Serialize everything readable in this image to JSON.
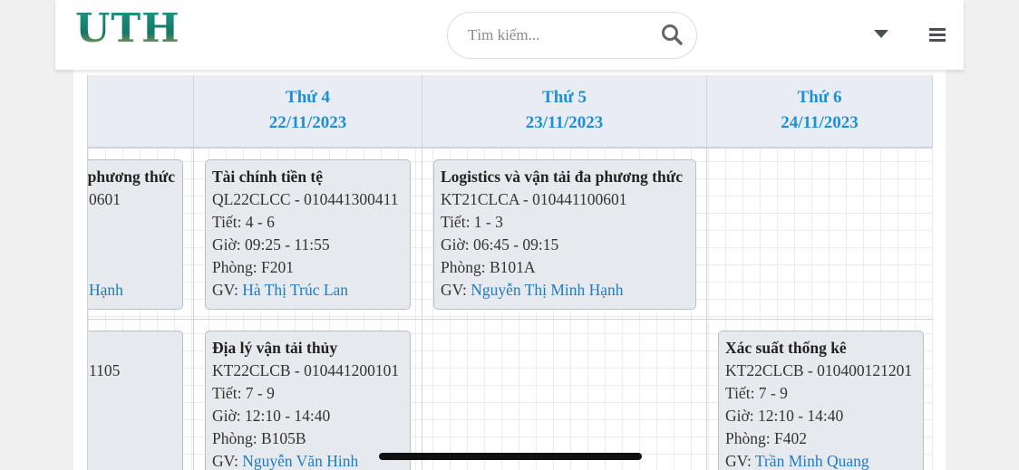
{
  "header": {
    "logo": "UTH",
    "search_placeholder": "Tìm kiếm..."
  },
  "days": [
    {
      "label": "Thứ 4",
      "date": "22/11/2023"
    },
    {
      "label": "Thứ 5",
      "date": "23/11/2023"
    },
    {
      "label": "Thứ 6",
      "date": "24/11/2023"
    }
  ],
  "partial_cards": [
    {
      "line1": "phương thức",
      "line2": "0601",
      "line6": "Hạnh"
    },
    {
      "line2": "1105"
    }
  ],
  "classes": [
    {
      "title": "Tài chính tiền tệ",
      "code": "QL22CLCC - 010441300411",
      "period": "Tiết: 4 - 6",
      "time": "Giờ: 09:25 - 11:55",
      "room": "Phòng: F201",
      "gv_label": "GV:",
      "gv_name": "Hà Thị Trúc Lan"
    },
    {
      "title": "Logistics và vận tải đa phương thức",
      "code": "KT21CLCA - 010441100601",
      "period": "Tiết: 1 - 3",
      "time": "Giờ: 06:45 - 09:15",
      "room": "Phòng: B101A",
      "gv_label": "GV:",
      "gv_name": "Nguyễn Thị Minh Hạnh"
    },
    {
      "title": "Địa lý vận tải thủy",
      "code": "KT22CLCB - 010441200101",
      "period": "Tiết: 7 - 9",
      "time": "Giờ: 12:10 - 14:40",
      "room": "Phòng: B105B",
      "gv_label": "GV:",
      "gv_name": "Nguyễn Văn Hinh"
    },
    {
      "title": "Xác suất thống kê",
      "code": "KT22CLCB - 010400121201",
      "period": "Tiết: 7 - 9",
      "time": "Giờ: 12:10 - 14:40",
      "room": "Phòng: F402",
      "gv_label": "GV:",
      "gv_name": "Trần Minh Quang"
    }
  ],
  "colors": {
    "accent": "#1f8fd3",
    "brand": "#1a8f7f",
    "card_bg": "#e6eaef"
  },
  "icons": [
    "search-icon",
    "caret-down-icon",
    "hamburger-menu-icon"
  ]
}
